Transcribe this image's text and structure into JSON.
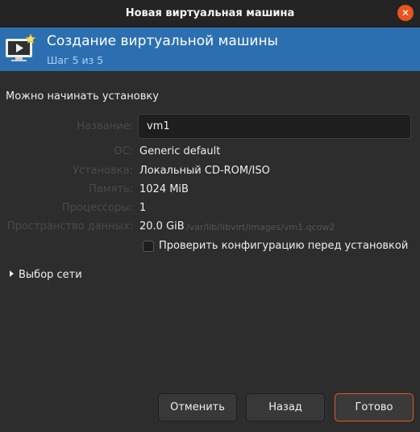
{
  "window": {
    "title": "Новая виртуальная машина",
    "close_glyph": "✕"
  },
  "header": {
    "title": "Создание виртуальной машины",
    "step": "Шаг 5 из 5",
    "icon": "vm-play-icon",
    "banner_color": "#2c6fb0"
  },
  "section_title": "Можно начинать установку",
  "summary": {
    "name": {
      "label": "Название:",
      "value": "vm1"
    },
    "os": {
      "label": "ОС:",
      "value": "Generic default"
    },
    "install": {
      "label": "Установка:",
      "value": "Локальный CD-ROM/ISO"
    },
    "memory": {
      "label": "Память:",
      "value": "1024 MiB"
    },
    "cpus": {
      "label": "Процессоры:",
      "value": "1"
    },
    "storage": {
      "label": "Пространство данных:",
      "value": "20.0 GiB",
      "path": "/var/lib/libvirt/images/vm1.qcow2"
    }
  },
  "customize_checkbox": {
    "label": "Проверить конфигурацию перед установкой",
    "checked": false
  },
  "network_expander": {
    "label": "Выбор сети",
    "expanded": false
  },
  "buttons": {
    "cancel": "Отменить",
    "back": "Назад",
    "finish": "Готово"
  },
  "colors": {
    "accent": "#e95420",
    "background": "#2d2d2d",
    "titlebar": "#242424"
  }
}
